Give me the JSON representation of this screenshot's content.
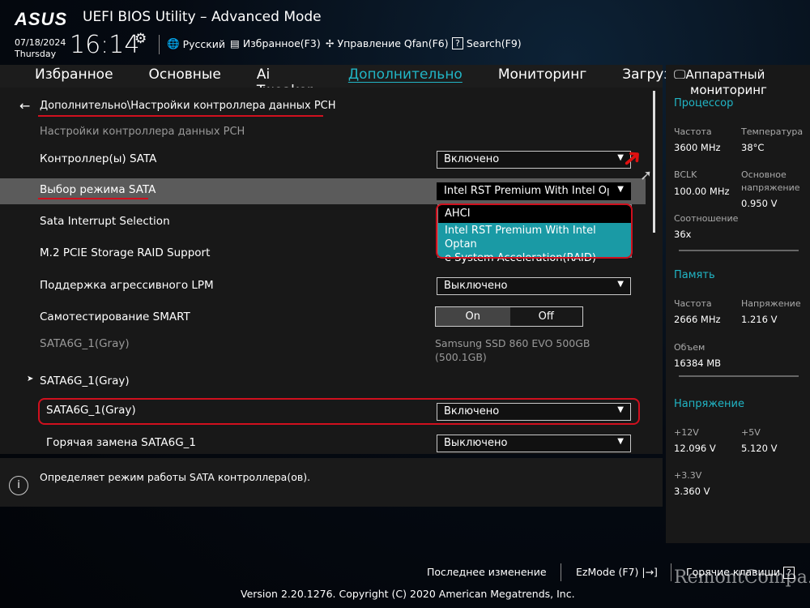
{
  "header": {
    "brand": "ASUS",
    "title": "UEFI BIOS Utility – Advanced Mode",
    "date": "07/18/2024",
    "day": "Thursday",
    "time": "16:14",
    "tools": [
      {
        "icon": "globe-icon",
        "label": "Русский"
      },
      {
        "icon": "favorites-icon",
        "label": "Избранное(F3)"
      },
      {
        "icon": "fan-icon",
        "label": "Управление Qfan(F6)"
      },
      {
        "icon": "question-icon",
        "label": "Search(F9)"
      }
    ]
  },
  "nav": {
    "tabs": [
      "Избранное",
      "Основные",
      "Ai Tweaker",
      "Дополнительно",
      "Мониторинг",
      "Загрузка"
    ],
    "active": "Дополнительно"
  },
  "main": {
    "breadcrumb": "Дополнительно\\Настройки контроллера данных PCH",
    "section": "Настройки контроллера данных PCH",
    "rows": [
      {
        "label": "Контроллер(ы) SATA",
        "value": "Включено"
      },
      {
        "label": "Выбор режима SATA",
        "value": "Intel RST Premium With Intel Oן"
      },
      {
        "label": "Sata Interrupt Selection"
      },
      {
        "label": "M.2 PCIE Storage RAID Support"
      },
      {
        "label": "Поддержка агрессивного LPM",
        "value": "Выключено"
      },
      {
        "label": "Самотестирование SMART",
        "on": "On",
        "off": "Off",
        "state": "On"
      },
      {
        "label": "SATA6G_1(Gray)",
        "info": "Samsung SSD 860 EVO 500GB",
        "info2": "(500.1GB)"
      },
      {
        "label": "SATA6G_1(Gray)"
      },
      {
        "label": "SATA6G_1(Gray)",
        "value": "Включено"
      },
      {
        "label": "Горячая замена SATA6G_1",
        "value": "Выключено"
      }
    ],
    "dropdown": {
      "options": [
        "AHCI",
        "Intel RST Premium With Intel Optan",
        "e System Acceleration(RAID)"
      ],
      "selected": 1
    }
  },
  "help": {
    "text": "Определяет режим работы SATA контроллера(ов)."
  },
  "monitor": {
    "title1": "Аппаратный",
    "title2": "мониторинг",
    "cpu": {
      "title": "Процессор",
      "freq_k": "Частота",
      "freq": "3600 MHz",
      "temp_k": "Температура",
      "temp": "38°C",
      "bclk_k": "BCLK",
      "bclk": "100.00 MHz",
      "vcore_k1": "Основное",
      "vcore_k2": "напряжение",
      "vcore": "0.950 V",
      "ratio_k": "Соотношение",
      "ratio": "36x"
    },
    "mem": {
      "title": "Память",
      "freq_k": "Частота",
      "freq": "2666 MHz",
      "volt_k": "Напряжение",
      "volt": "1.216 V",
      "cap_k": "Объем",
      "cap": "16384 MB"
    },
    "volt": {
      "title": "Напряжение",
      "v12_k": "+12V",
      "v12": "12.096 V",
      "v5_k": "+5V",
      "v5": "5.120 V",
      "v33_k": "+3.3V",
      "v33": "3.360 V"
    }
  },
  "footer": {
    "last": "Последнее изменение",
    "ezmode": "EzMode (F7)",
    "hotkeys": "Горячие клавиши",
    "version": "Version 2.20.1276. Copyright (C) 2020 American Megatrends, Inc.",
    "watermark": "RemontCompa.ru"
  },
  "colors": {
    "accent": "#21b5c5",
    "highlight": "#d0101e"
  }
}
